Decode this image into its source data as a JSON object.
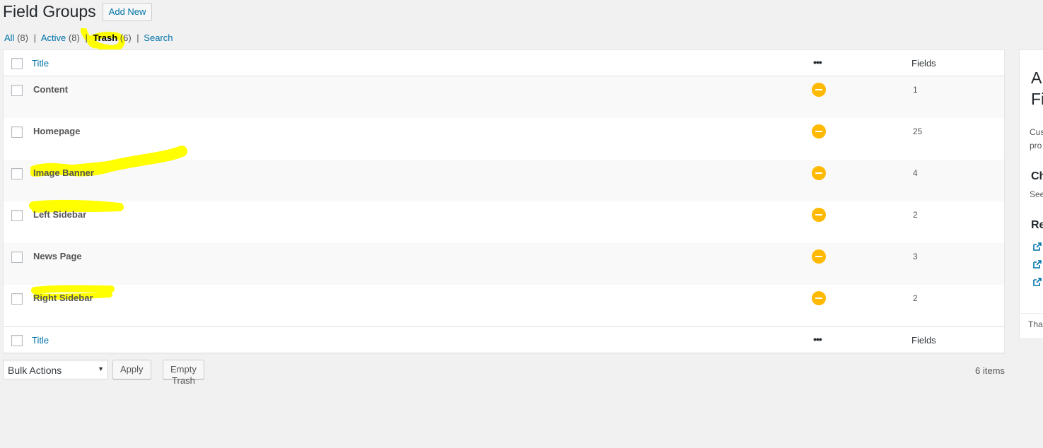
{
  "header": {
    "title": "Field Groups",
    "add_new": "Add New"
  },
  "filters": {
    "all_label": "All",
    "all_count": "(8)",
    "active_label": "Active",
    "active_count": "(8)",
    "trash_label": "Trash",
    "trash_count": "(6)",
    "search_label": "Search",
    "separator": "|"
  },
  "table": {
    "columns": {
      "title": "Title",
      "status_icon": "more-dots-icon",
      "status": "•••",
      "fields": "Fields"
    },
    "rows": [
      {
        "title": "Content",
        "fields": "1",
        "highlighted": false
      },
      {
        "title": "Homepage",
        "fields": "25",
        "highlighted": false
      },
      {
        "title": "Image Banner",
        "fields": "4",
        "highlighted": true
      },
      {
        "title": "Left Sidebar",
        "fields": "2",
        "highlighted": true
      },
      {
        "title": "News Page",
        "fields": "3",
        "highlighted": false
      },
      {
        "title": "Right Sidebar",
        "fields": "2",
        "highlighted": true
      }
    ],
    "row_status_icon": "minus-circle-icon"
  },
  "tablenav": {
    "bulk_actions": "Bulk Actions",
    "apply": "Apply",
    "empty_trash": "Empty Trash",
    "items_count": "6 items"
  },
  "sidebar": {
    "title": "A\nFi",
    "text1": "Cus",
    "text2": "pro",
    "heading1": "Ch",
    "text3": "See",
    "heading2": "Re",
    "link_icon": "external-link-icon",
    "footer": "Tha"
  },
  "colors": {
    "accent": "#0073aa",
    "status": "#ffb900",
    "highlight": "#ffff00"
  }
}
